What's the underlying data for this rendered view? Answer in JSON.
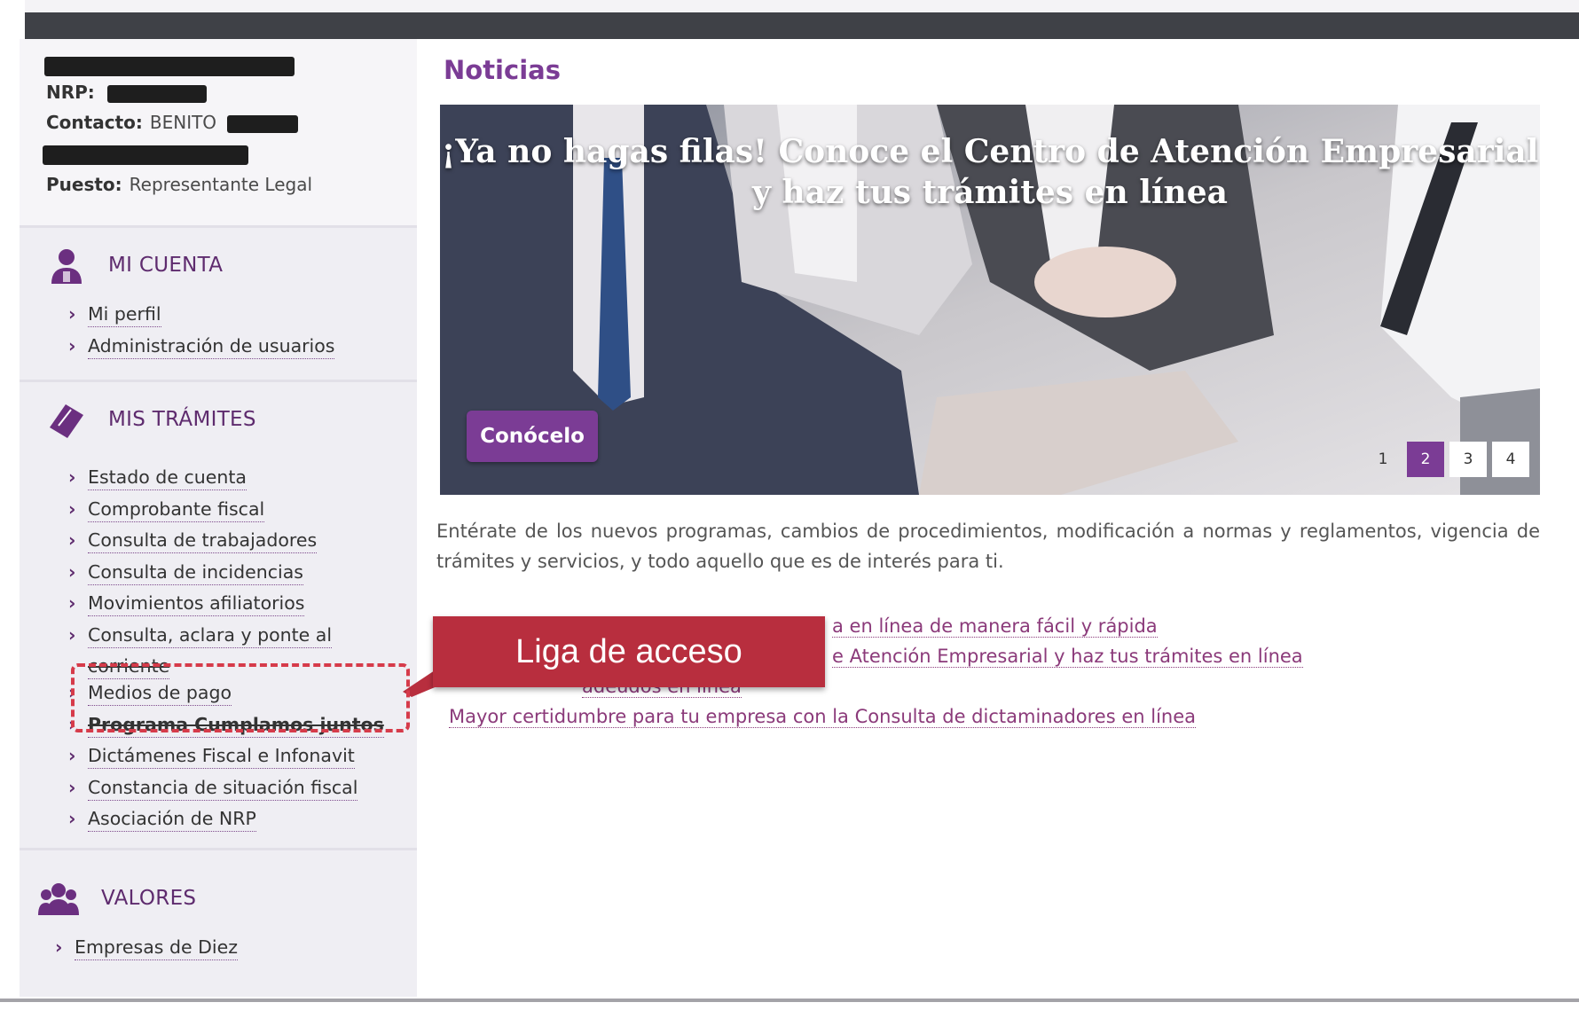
{
  "profile": {
    "nrp_label": "NRP:",
    "contact_label": "Contacto:",
    "contact_name": "BENITO",
    "position_label": "Puesto:",
    "position_value": "Representante Legal"
  },
  "sidebar": {
    "sections": [
      {
        "title": "MI CUENTA",
        "icon": "user-icon",
        "items": [
          "Mi perfil",
          "Administración de usuarios"
        ]
      },
      {
        "title": "MIS TRÁMITES",
        "icon": "document-icon",
        "items": [
          "Estado de cuenta",
          "Comprobante fiscal",
          "Consulta de trabajadores",
          "Consulta de incidencias",
          "Movimientos afiliatorios",
          "Consulta, aclara y ponte al",
          "corriente",
          "Medios de pago",
          "Programa Cumplamos juntos",
          "Dictámenes Fiscal e Infonavit",
          "Constancia de situación fiscal",
          "Asociación de NRP"
        ]
      },
      {
        "title": "VALORES",
        "icon": "group-icon",
        "items": [
          "Empresas de Diez"
        ]
      }
    ]
  },
  "main": {
    "title": "Noticias",
    "banner": {
      "headline_line1": "¡Ya no hagas filas! Conoce el Centro de Atención Empresarial",
      "headline_line2": "y haz tus trámites en línea",
      "button_label": "Conócelo",
      "pages": [
        "1",
        "2",
        "3",
        "4"
      ],
      "active_page": "2"
    },
    "intro": "Entérate de los nuevos programas, cambios de procedimientos, modificación a normas y reglamentos, vigencia de trámites y servicios, y todo aquello que es de interés para ti.",
    "news_links": [
      "a en línea de manera fácil y rápida",
      "e Atención Empresarial y haz tus trámites en línea",
      "adeudos en línea",
      "Mayor certidumbre para tu empresa con la Consulta de dictaminadores en línea"
    ]
  },
  "annotation": {
    "callout_text": "Liga de acceso",
    "color": "#b82e3e"
  },
  "colors": {
    "brand_purple": "#7b3c95",
    "sidebar_bg": "#efeef3",
    "topbar": "#3f4147"
  }
}
